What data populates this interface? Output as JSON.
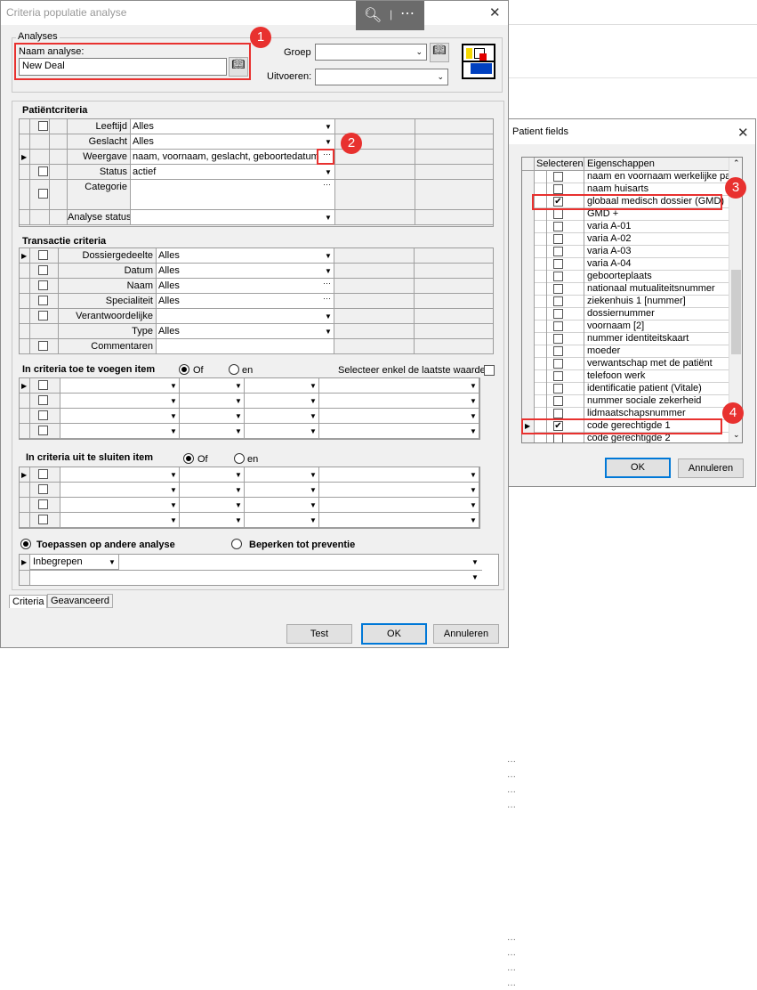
{
  "main": {
    "title": "Criteria populatie analyse",
    "analyses": {
      "group_label": "Analyses",
      "name_label": "Naam analyse:",
      "name_value": "New Deal",
      "groep_label": "Groep",
      "uitvoeren_label": "Uitvoeren:"
    },
    "patient": {
      "header": "Patiëntcriteria",
      "rows": [
        {
          "label": "Leeftijd",
          "value": "Alles"
        },
        {
          "label": "Geslacht",
          "value": "Alles"
        },
        {
          "label": "Weergave",
          "value": "naam, voornaam, geslacht, geboortedatum"
        },
        {
          "label": "Status",
          "value": "actief"
        },
        {
          "label": "Categorie",
          "value": ""
        },
        {
          "label": "Analyse status",
          "value": ""
        }
      ]
    },
    "transaction": {
      "header": "Transactie criteria",
      "rows": [
        {
          "label": "Dossiergedeelte",
          "value": "Alles"
        },
        {
          "label": "Datum",
          "value": "Alles"
        },
        {
          "label": "Naam",
          "value": "Alles"
        },
        {
          "label": "Specialiteit",
          "value": "Alles"
        },
        {
          "label": "Verantwoordelijke",
          "value": ""
        },
        {
          "label": "Type",
          "value": "Alles"
        },
        {
          "label": "Commentaren",
          "value": ""
        }
      ]
    },
    "include": {
      "header": "In criteria toe te voegen item",
      "of": "Of",
      "en": "en",
      "last_value": "Selecteer enkel de laatste waarde"
    },
    "exclude": {
      "header": "In criteria uit te sluiten item",
      "of": "Of",
      "en": "en"
    },
    "apply": {
      "option1": "Toepassen op andere analyse",
      "option2": "Beperken tot preventie",
      "inbegrepen": "Inbegrepen"
    },
    "tabs": [
      "Criteria",
      "Geavanceerd"
    ],
    "buttons": {
      "test": "Test",
      "ok": "OK",
      "cancel": "Annuleren"
    },
    "toolbar": {
      "zoom_icon": "zoom-in-icon",
      "more": "⋯"
    }
  },
  "patient_fields": {
    "title": "Patient fields",
    "col_select": "Selecteren",
    "col_props": "Eigenschappen",
    "items": [
      {
        "label": "naam en voornaam werkelijke pa",
        "checked": false
      },
      {
        "label": "naam huisarts",
        "checked": false
      },
      {
        "label": "globaal medisch dossier (GMD)",
        "checked": true
      },
      {
        "label": "GMD +",
        "checked": false
      },
      {
        "label": "varia A-01",
        "checked": false
      },
      {
        "label": "varia A-02",
        "checked": false
      },
      {
        "label": "varia A-03",
        "checked": false
      },
      {
        "label": "varia A-04",
        "checked": false
      },
      {
        "label": "geboorteplaats",
        "checked": false
      },
      {
        "label": "nationaal mutualiteitsnummer",
        "checked": false
      },
      {
        "label": "ziekenhuis 1 [nummer]",
        "checked": false
      },
      {
        "label": "dossiernummer",
        "checked": false
      },
      {
        "label": "voornaam [2]",
        "checked": false
      },
      {
        "label": "nummer identiteitskaart",
        "checked": false
      },
      {
        "label": "moeder",
        "checked": false
      },
      {
        "label": "verwantschap met de patiënt",
        "checked": false
      },
      {
        "label": "telefoon werk",
        "checked": false
      },
      {
        "label": "identificatie patient (Vitale)",
        "checked": false
      },
      {
        "label": "nummer sociale zekerheid",
        "checked": false
      },
      {
        "label": "lidmaatschapsnummer",
        "checked": false
      },
      {
        "label": "code gerechtigde 1",
        "checked": true
      },
      {
        "label": "code gerechtigde 2",
        "checked": false
      }
    ],
    "ok": "OK",
    "cancel": "Annuleren"
  },
  "markers": [
    "1",
    "2",
    "3",
    "4"
  ],
  "colors": {
    "marker": "#e8312f",
    "accent": "#0078d7"
  }
}
